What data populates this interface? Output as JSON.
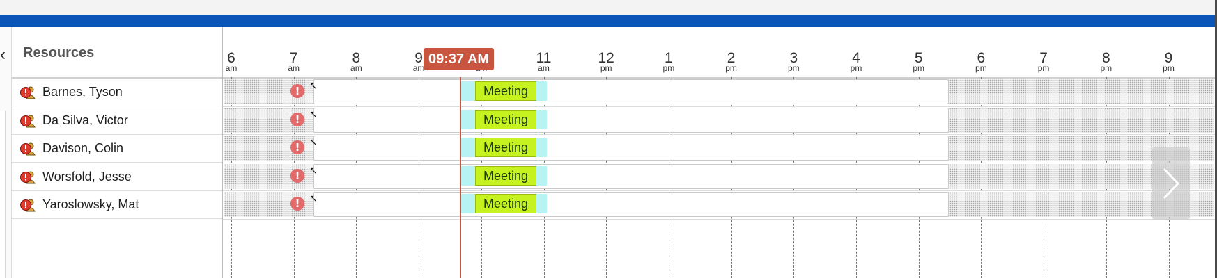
{
  "resources_panel": {
    "title": "Resources",
    "rows": [
      {
        "name": "Barnes, Tyson"
      },
      {
        "name": "Da Silva, Victor"
      },
      {
        "name": "Davison, Colin"
      },
      {
        "name": "Worsfold, Jesse"
      },
      {
        "name": "Yaroslowsky, Mat"
      }
    ],
    "row_icon": "alert-person-icon"
  },
  "timeline": {
    "hours": [
      {
        "num": "6",
        "ampm": "am"
      },
      {
        "num": "7",
        "ampm": "am"
      },
      {
        "num": "8",
        "ampm": "am"
      },
      {
        "num": "9",
        "ampm": "am"
      },
      {
        "num": "10",
        "ampm": "am"
      },
      {
        "num": "11",
        "ampm": "am"
      },
      {
        "num": "12",
        "ampm": "pm"
      },
      {
        "num": "1",
        "ampm": "pm"
      },
      {
        "num": "2",
        "ampm": "pm"
      },
      {
        "num": "3",
        "ampm": "pm"
      },
      {
        "num": "4",
        "ampm": "pm"
      },
      {
        "num": "5",
        "ampm": "pm"
      },
      {
        "num": "6",
        "ampm": "pm"
      },
      {
        "num": "7",
        "ampm": "pm"
      },
      {
        "num": "8",
        "ampm": "pm"
      },
      {
        "num": "9",
        "ampm": "pm"
      }
    ],
    "current_time": "09:37 AM",
    "event_label": "Meeting",
    "warning_glyph": "!"
  },
  "colors": {
    "header_bar": "#0b54b8",
    "now_indicator": "#c8553d",
    "meeting": "#c6f21f",
    "travel": "#b7f3f3",
    "warning": "#e26a6a"
  },
  "icons": {
    "collapse": "chevron-left-icon",
    "next": "chevron-right-icon"
  }
}
